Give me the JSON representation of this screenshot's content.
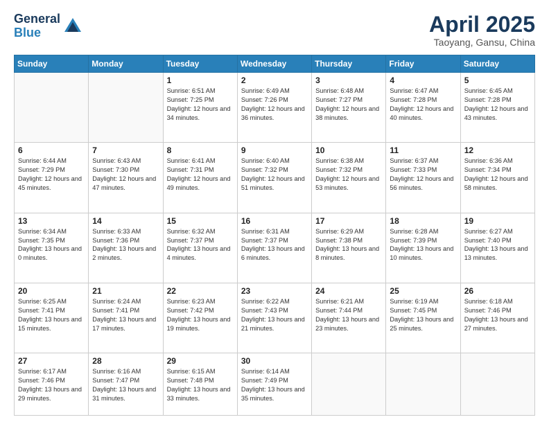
{
  "header": {
    "logo_general": "General",
    "logo_blue": "Blue",
    "title": "April 2025",
    "location": "Taoyang, Gansu, China"
  },
  "weekdays": [
    "Sunday",
    "Monday",
    "Tuesday",
    "Wednesday",
    "Thursday",
    "Friday",
    "Saturday"
  ],
  "weeks": [
    [
      {
        "day": "",
        "text": ""
      },
      {
        "day": "",
        "text": ""
      },
      {
        "day": "1",
        "text": "Sunrise: 6:51 AM\nSunset: 7:25 PM\nDaylight: 12 hours and 34 minutes."
      },
      {
        "day": "2",
        "text": "Sunrise: 6:49 AM\nSunset: 7:26 PM\nDaylight: 12 hours and 36 minutes."
      },
      {
        "day": "3",
        "text": "Sunrise: 6:48 AM\nSunset: 7:27 PM\nDaylight: 12 hours and 38 minutes."
      },
      {
        "day": "4",
        "text": "Sunrise: 6:47 AM\nSunset: 7:28 PM\nDaylight: 12 hours and 40 minutes."
      },
      {
        "day": "5",
        "text": "Sunrise: 6:45 AM\nSunset: 7:28 PM\nDaylight: 12 hours and 43 minutes."
      }
    ],
    [
      {
        "day": "6",
        "text": "Sunrise: 6:44 AM\nSunset: 7:29 PM\nDaylight: 12 hours and 45 minutes."
      },
      {
        "day": "7",
        "text": "Sunrise: 6:43 AM\nSunset: 7:30 PM\nDaylight: 12 hours and 47 minutes."
      },
      {
        "day": "8",
        "text": "Sunrise: 6:41 AM\nSunset: 7:31 PM\nDaylight: 12 hours and 49 minutes."
      },
      {
        "day": "9",
        "text": "Sunrise: 6:40 AM\nSunset: 7:32 PM\nDaylight: 12 hours and 51 minutes."
      },
      {
        "day": "10",
        "text": "Sunrise: 6:38 AM\nSunset: 7:32 PM\nDaylight: 12 hours and 53 minutes."
      },
      {
        "day": "11",
        "text": "Sunrise: 6:37 AM\nSunset: 7:33 PM\nDaylight: 12 hours and 56 minutes."
      },
      {
        "day": "12",
        "text": "Sunrise: 6:36 AM\nSunset: 7:34 PM\nDaylight: 12 hours and 58 minutes."
      }
    ],
    [
      {
        "day": "13",
        "text": "Sunrise: 6:34 AM\nSunset: 7:35 PM\nDaylight: 13 hours and 0 minutes."
      },
      {
        "day": "14",
        "text": "Sunrise: 6:33 AM\nSunset: 7:36 PM\nDaylight: 13 hours and 2 minutes."
      },
      {
        "day": "15",
        "text": "Sunrise: 6:32 AM\nSunset: 7:37 PM\nDaylight: 13 hours and 4 minutes."
      },
      {
        "day": "16",
        "text": "Sunrise: 6:31 AM\nSunset: 7:37 PM\nDaylight: 13 hours and 6 minutes."
      },
      {
        "day": "17",
        "text": "Sunrise: 6:29 AM\nSunset: 7:38 PM\nDaylight: 13 hours and 8 minutes."
      },
      {
        "day": "18",
        "text": "Sunrise: 6:28 AM\nSunset: 7:39 PM\nDaylight: 13 hours and 10 minutes."
      },
      {
        "day": "19",
        "text": "Sunrise: 6:27 AM\nSunset: 7:40 PM\nDaylight: 13 hours and 13 minutes."
      }
    ],
    [
      {
        "day": "20",
        "text": "Sunrise: 6:25 AM\nSunset: 7:41 PM\nDaylight: 13 hours and 15 minutes."
      },
      {
        "day": "21",
        "text": "Sunrise: 6:24 AM\nSunset: 7:41 PM\nDaylight: 13 hours and 17 minutes."
      },
      {
        "day": "22",
        "text": "Sunrise: 6:23 AM\nSunset: 7:42 PM\nDaylight: 13 hours and 19 minutes."
      },
      {
        "day": "23",
        "text": "Sunrise: 6:22 AM\nSunset: 7:43 PM\nDaylight: 13 hours and 21 minutes."
      },
      {
        "day": "24",
        "text": "Sunrise: 6:21 AM\nSunset: 7:44 PM\nDaylight: 13 hours and 23 minutes."
      },
      {
        "day": "25",
        "text": "Sunrise: 6:19 AM\nSunset: 7:45 PM\nDaylight: 13 hours and 25 minutes."
      },
      {
        "day": "26",
        "text": "Sunrise: 6:18 AM\nSunset: 7:46 PM\nDaylight: 13 hours and 27 minutes."
      }
    ],
    [
      {
        "day": "27",
        "text": "Sunrise: 6:17 AM\nSunset: 7:46 PM\nDaylight: 13 hours and 29 minutes."
      },
      {
        "day": "28",
        "text": "Sunrise: 6:16 AM\nSunset: 7:47 PM\nDaylight: 13 hours and 31 minutes."
      },
      {
        "day": "29",
        "text": "Sunrise: 6:15 AM\nSunset: 7:48 PM\nDaylight: 13 hours and 33 minutes."
      },
      {
        "day": "30",
        "text": "Sunrise: 6:14 AM\nSunset: 7:49 PM\nDaylight: 13 hours and 35 minutes."
      },
      {
        "day": "",
        "text": ""
      },
      {
        "day": "",
        "text": ""
      },
      {
        "day": "",
        "text": ""
      }
    ]
  ]
}
